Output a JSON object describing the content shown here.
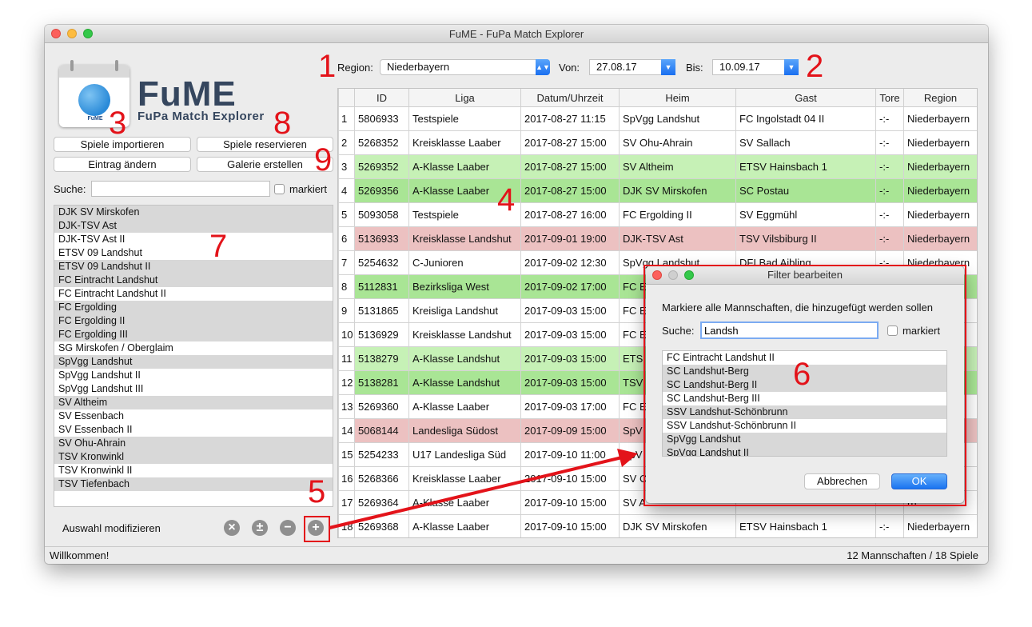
{
  "window": {
    "title": "FuME - FuPa Match Explorer"
  },
  "logo": {
    "name": "FuME",
    "subtitle": "FuPa Match Explorer",
    "badge_text": "FuME"
  },
  "buttons": {
    "import": "Spiele importieren",
    "reserve": "Spiele reservieren",
    "edit": "Eintrag ändern",
    "gallery": "Galerie erstellen"
  },
  "search": {
    "label": "Suche:",
    "value": "",
    "marked_label": "markiert"
  },
  "teams": [
    {
      "name": "DJK SV Mirskofen",
      "selected": true
    },
    {
      "name": "DJK-TSV Ast",
      "selected": true
    },
    {
      "name": "DJK-TSV Ast II",
      "selected": false
    },
    {
      "name": "ETSV 09 Landshut",
      "selected": false
    },
    {
      "name": "ETSV 09 Landshut II",
      "selected": true
    },
    {
      "name": "FC Eintracht Landshut",
      "selected": true
    },
    {
      "name": "FC Eintracht Landshut II",
      "selected": false
    },
    {
      "name": "FC Ergolding",
      "selected": true
    },
    {
      "name": "FC Ergolding II",
      "selected": true
    },
    {
      "name": "FC Ergolding III",
      "selected": true
    },
    {
      "name": "SG Mirskofen / Oberglaim",
      "selected": false
    },
    {
      "name": "SpVgg Landshut",
      "selected": true
    },
    {
      "name": "SpVgg Landshut II",
      "selected": false
    },
    {
      "name": "SpVgg Landshut III",
      "selected": false
    },
    {
      "name": "SV Altheim",
      "selected": true
    },
    {
      "name": "SV Essenbach",
      "selected": false
    },
    {
      "name": "SV Essenbach II",
      "selected": false
    },
    {
      "name": "SV Ohu-Ahrain",
      "selected": true
    },
    {
      "name": "TSV Kronwinkl",
      "selected": true
    },
    {
      "name": "TSV Kronwinkl II",
      "selected": false
    },
    {
      "name": "TSV Tiefenbach",
      "selected": true
    }
  ],
  "modify": {
    "label": "Auswahl modifizieren",
    "icons": [
      "clear-icon",
      "invert-icon",
      "remove-icon",
      "add-icon"
    ]
  },
  "filters": {
    "region_label": "Region:",
    "region_value": "Niederbayern",
    "from_label": "Von:",
    "from_value": "27.08.17",
    "to_label": "Bis:",
    "to_value": "10.09.17"
  },
  "table": {
    "headers": [
      "",
      "ID",
      "Liga",
      "Datum/Uhrzeit",
      "Heim",
      "Gast",
      "Tore",
      "Region"
    ],
    "rows": [
      {
        "n": "1",
        "id": "5806933",
        "liga": "Testspiele",
        "date": "2017-08-27 11:15",
        "home": "SpVgg Landshut",
        "away": "FC Ingolstadt 04 II",
        "score": "-:-",
        "region": "Niederbayern",
        "color": "white"
      },
      {
        "n": "2",
        "id": "5268352",
        "liga": "Kreisklasse Laaber",
        "date": "2017-08-27 15:00",
        "home": "SV Ohu-Ahrain",
        "away": "SV Sallach",
        "score": "-:-",
        "region": "Niederbayern",
        "color": "white"
      },
      {
        "n": "3",
        "id": "5269352",
        "liga": "A-Klasse Laaber",
        "date": "2017-08-27 15:00",
        "home": "SV Altheim",
        "away": "ETSV Hainsbach 1",
        "score": "-:-",
        "region": "Niederbayern",
        "color": "green"
      },
      {
        "n": "4",
        "id": "5269356",
        "liga": "A-Klasse Laaber",
        "date": "2017-08-27 15:00",
        "home": "DJK SV Mirskofen",
        "away": "SC Postau",
        "score": "-:-",
        "region": "Niederbayern",
        "color": "dg"
      },
      {
        "n": "5",
        "id": "5093058",
        "liga": "Testspiele",
        "date": "2017-08-27 16:00",
        "home": "FC Ergolding II",
        "away": "SV Eggmühl",
        "score": "-:-",
        "region": "Niederbayern",
        "color": "white"
      },
      {
        "n": "6",
        "id": "5136933",
        "liga": "Kreisklasse Landshut",
        "date": "2017-09-01 19:00",
        "home": "DJK-TSV Ast",
        "away": "TSV Vilsbiburg II",
        "score": "-:-",
        "region": "Niederbayern",
        "color": "red"
      },
      {
        "n": "7",
        "id": "5254632",
        "liga": "C-Junioren",
        "date": "2017-09-02 12:30",
        "home": "SpVgg Landshut",
        "away": "DFI Bad Aibling",
        "score": "-:-",
        "region": "Niederbayern",
        "color": "white"
      },
      {
        "n": "8",
        "id": "5112831",
        "liga": "Bezirksliga West",
        "date": "2017-09-02 17:00",
        "home": "FC E",
        "away": "",
        "score": "",
        "region": "rn",
        "color": "dg"
      },
      {
        "n": "9",
        "id": "5131865",
        "liga": "Kreisliga Landshut",
        "date": "2017-09-03 15:00",
        "home": "FC E",
        "away": "",
        "score": "",
        "region": "rn",
        "color": "white"
      },
      {
        "n": "10",
        "id": "5136929",
        "liga": "Kreisklasse Landshut",
        "date": "2017-09-03 15:00",
        "home": "FC E",
        "away": "",
        "score": "",
        "region": "rn",
        "color": "white"
      },
      {
        "n": "11",
        "id": "5138279",
        "liga": "A-Klasse Landshut",
        "date": "2017-09-03 15:00",
        "home": "ETS",
        "away": "",
        "score": "",
        "region": "rn",
        "color": "green"
      },
      {
        "n": "12",
        "id": "5138281",
        "liga": "A-Klasse Landshut",
        "date": "2017-09-03 15:00",
        "home": "TSV",
        "away": "",
        "score": "",
        "region": "rn",
        "color": "dg"
      },
      {
        "n": "13",
        "id": "5269360",
        "liga": "A-Klasse Laaber",
        "date": "2017-09-03 17:00",
        "home": "FC E",
        "away": "",
        "score": "",
        "region": "rn",
        "color": "white"
      },
      {
        "n": "14",
        "id": "5068144",
        "liga": "Landesliga Südost",
        "date": "2017-09-09 15:00",
        "home": "SpV",
        "away": "",
        "score": "",
        "region": "rn",
        "color": "red"
      },
      {
        "n": "15",
        "id": "5254233",
        "liga": "U17 Landesliga Süd",
        "date": "2017-09-10 11:00",
        "home": "SpV",
        "away": "",
        "score": "",
        "region": "rn",
        "color": "white"
      },
      {
        "n": "16",
        "id": "5268366",
        "liga": "Kreisklasse Laaber",
        "date": "2017-09-10 15:00",
        "home": "SV C",
        "away": "",
        "score": "",
        "region": "rn",
        "color": "white"
      },
      {
        "n": "17",
        "id": "5269364",
        "liga": "A-Klasse Laaber",
        "date": "2017-09-10 15:00",
        "home": "SV A",
        "away": "",
        "score": "",
        "region": "rn",
        "color": "white"
      },
      {
        "n": "18",
        "id": "5269368",
        "liga": "A-Klasse Laaber",
        "date": "2017-09-10 15:00",
        "home": "DJK SV Mirskofen",
        "away": "ETSV Hainsbach 1",
        "score": "-:-",
        "region": "Niederbayern",
        "color": "white"
      }
    ]
  },
  "status": {
    "left": "Willkommen!",
    "right": "12 Mannschaften / 18 Spiele"
  },
  "dialog": {
    "title": "Filter bearbeiten",
    "instruction": "Markiere alle Mannschaften, die hinzugefügt werden sollen",
    "search_label": "Suche:",
    "search_value": "Landsh",
    "marked_label": "markiert",
    "items": [
      {
        "name": "FC Eintracht Landshut II",
        "selected": false
      },
      {
        "name": "SC Landshut-Berg",
        "selected": true
      },
      {
        "name": "SC Landshut-Berg II",
        "selected": true
      },
      {
        "name": "SC Landshut-Berg III",
        "selected": false
      },
      {
        "name": "SSV Landshut-Schönbrunn",
        "selected": true
      },
      {
        "name": "SSV Landshut-Schönbrunn II",
        "selected": false
      },
      {
        "name": "SpVgg Landshut",
        "selected": true
      },
      {
        "name": "SpVgg Landshut II",
        "selected": true
      }
    ],
    "cancel": "Abbrechen",
    "ok": "OK"
  },
  "annotations": [
    "1",
    "2",
    "3",
    "4",
    "5",
    "6",
    "7",
    "8",
    "9"
  ],
  "colors": {
    "accent": "#1a6ff0",
    "annotation": "#e3131a",
    "row_green": "#c6f1b6",
    "row_dark_green": "#a9e595",
    "row_red": "#ecc1c1"
  }
}
